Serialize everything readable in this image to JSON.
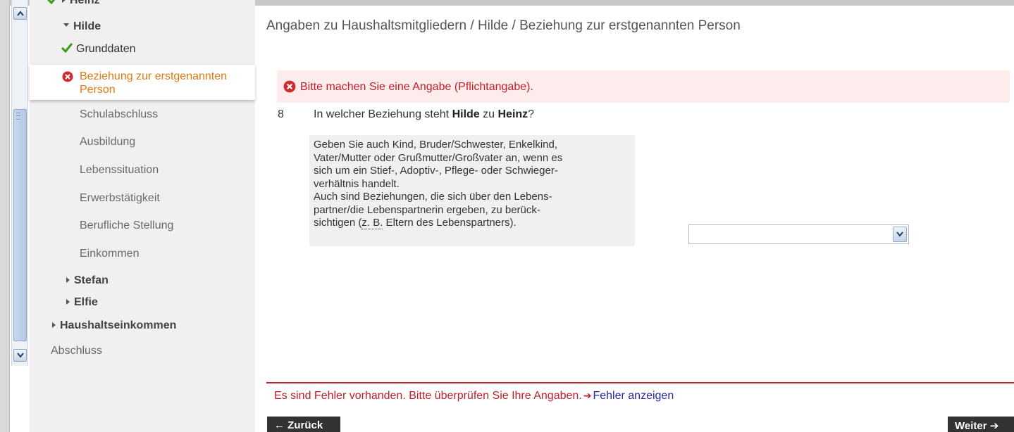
{
  "nav": {
    "person_heinz": "Heinz",
    "person_hilde": "Hilde",
    "hilde_items": {
      "grunddaten": "Grunddaten",
      "beziehung": "Beziehung zur erstgenannten Person",
      "schulabschluss": "Schulabschluss",
      "ausbildung": "Ausbildung",
      "lebenssituation": "Lebenssituation",
      "erwerbstaetigkeit": "Erwerbstätigkeit",
      "berufliche_stellung": "Berufliche Stellung",
      "einkommen": "Einkommen"
    },
    "person_stefan": "Stefan",
    "person_elfie": "Elfie",
    "haushaltseinkommen": "Haushaltseinkommen",
    "abschluss": "Abschluss"
  },
  "main": {
    "breadcrumb": "Angaben zu Haushaltsmitgliedern / Hilde / Beziehung zur erstgenannten Person",
    "error_message": "Bitte machen Sie eine Angabe (Pflichtangabe).",
    "question": {
      "number": "8",
      "text_before": "In welcher Beziehung steht ",
      "subject": "Hilde",
      "text_middle": " zu ",
      "reference": "Heinz",
      "text_after": "?"
    },
    "hint": {
      "line1": "Geben Sie auch Kind, Bruder/Schwester, Enkelkind,",
      "line2": "Vater/Mutter oder Grußmutter/Großvater an, wenn es",
      "line3": "sich um ein Stief-, Adoptiv-, Pflege- oder Schwieger-",
      "line4": "verhältnis handelt.",
      "line5": "Auch sind Beziehungen, die sich über den Lebens-",
      "line6": "partner/die Lebenspartnerin ergeben, zu berück-",
      "line7_before": "sichtigen (",
      "line7_abbr": "z. B.",
      "line7_after": " Eltern des Lebenspartners)."
    },
    "relationship_select": {
      "value": ""
    }
  },
  "footer": {
    "error_text": "Es sind Fehler vorhanden. Bitte überprüfen Sie Ihre Angaben.",
    "show_errors_link": "Fehler anzeigen",
    "back_button": "← Zurück",
    "next_button": "Weiter ➔"
  },
  "colors": {
    "error_red": "#c0202a",
    "active_orange": "#e07a10",
    "check_green": "#3a9a1a",
    "link_blue": "#2a2aa8"
  }
}
